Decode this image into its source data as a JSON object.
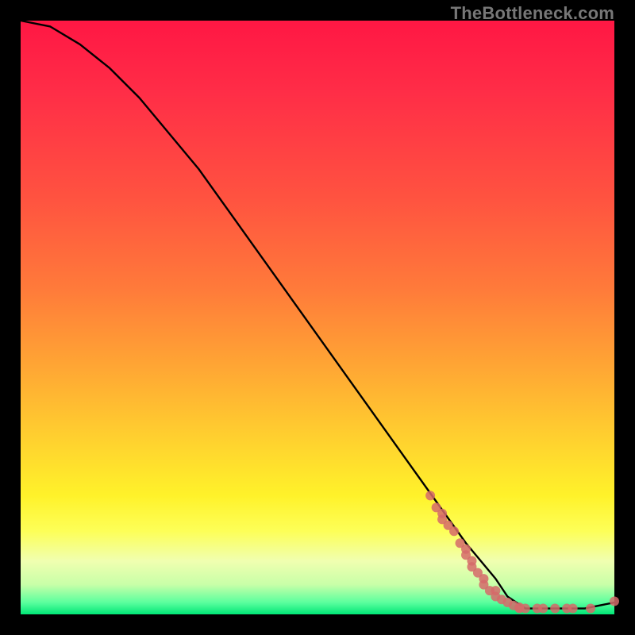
{
  "watermark": "TheBottleneck.com",
  "chart_data": {
    "type": "line",
    "title": "",
    "xlabel": "",
    "ylabel": "",
    "xlim": [
      0,
      100
    ],
    "ylim": [
      0,
      100
    ],
    "grid": false,
    "legend": false,
    "background_gradient": {
      "top_color": "#ff1744",
      "bottom_color": "#00e676"
    },
    "series": [
      {
        "name": "bottleneck-curve",
        "type": "line",
        "color": "#000000",
        "x": [
          0,
          5,
          10,
          15,
          20,
          25,
          30,
          35,
          40,
          45,
          50,
          55,
          60,
          65,
          70,
          75,
          80,
          82,
          85,
          90,
          95,
          100
        ],
        "y": [
          100,
          99,
          96,
          92,
          87,
          81,
          75,
          68,
          61,
          54,
          47,
          40,
          33,
          26,
          19,
          12,
          6,
          3,
          1,
          1,
          1,
          2
        ]
      },
      {
        "name": "scatter-points",
        "type": "scatter",
        "color": "#d56a6a",
        "x": [
          69,
          70,
          71,
          71,
          72,
          73,
          74,
          75,
          75,
          76,
          76,
          77,
          78,
          78,
          79,
          80,
          80,
          81,
          82,
          83,
          84,
          84,
          85,
          87,
          88,
          90,
          92,
          93,
          96,
          100
        ],
        "y": [
          20,
          18,
          17,
          16,
          15,
          14,
          12,
          11,
          10,
          9,
          8,
          7,
          6,
          5,
          4,
          4,
          3,
          2.5,
          2,
          1.5,
          1.2,
          1,
          1,
          1,
          1,
          1,
          1,
          1,
          1,
          2.2
        ]
      }
    ]
  }
}
